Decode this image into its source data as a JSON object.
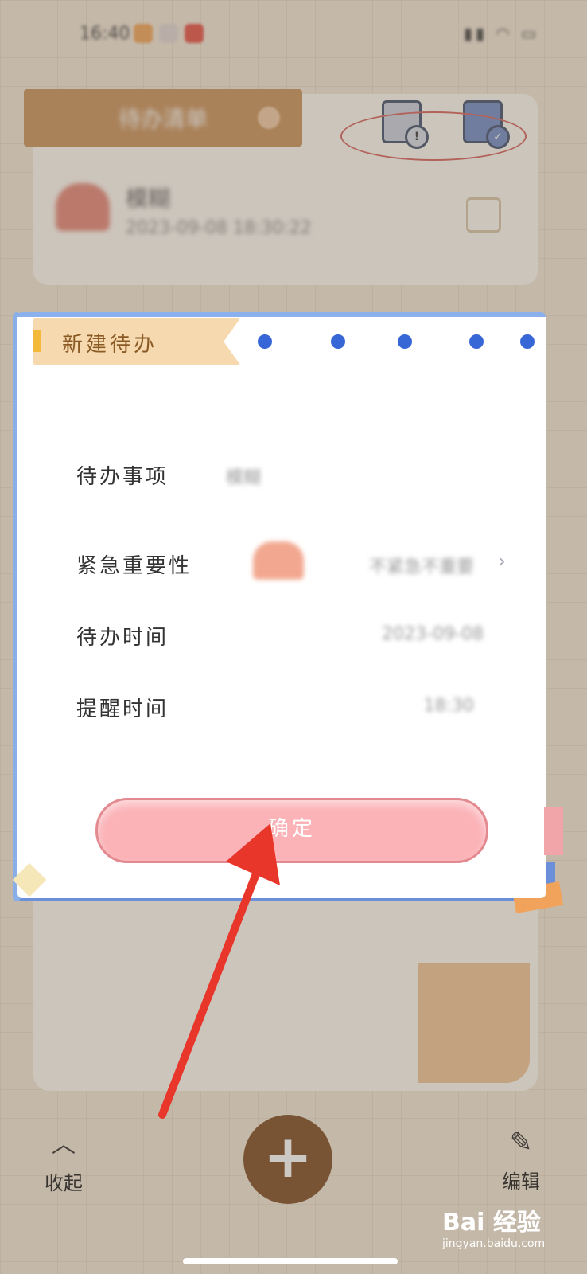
{
  "dialog": {
    "title": "新建待办",
    "rows": [
      {
        "label": "待办事项",
        "value": "模糊"
      },
      {
        "label": "紧急重要性",
        "value": "不紧急不重要"
      },
      {
        "label": "待办时间",
        "value": "2023-09-08"
      },
      {
        "label": "提醒时间",
        "value": "18:30"
      }
    ],
    "confirm_label": "确定"
  },
  "toolbar": {
    "collapse_label": "收起",
    "add_glyph": "+",
    "edit_label": "编辑"
  },
  "header": {
    "list_title": "待办清单"
  },
  "watermark": {
    "site": "jingyan.baidu.com",
    "logo": "Bai 经验"
  },
  "colors": {
    "confirm_bg": "#fbb3b8",
    "fab_bg": "#7a4418",
    "annotation_red": "#e8362b"
  }
}
